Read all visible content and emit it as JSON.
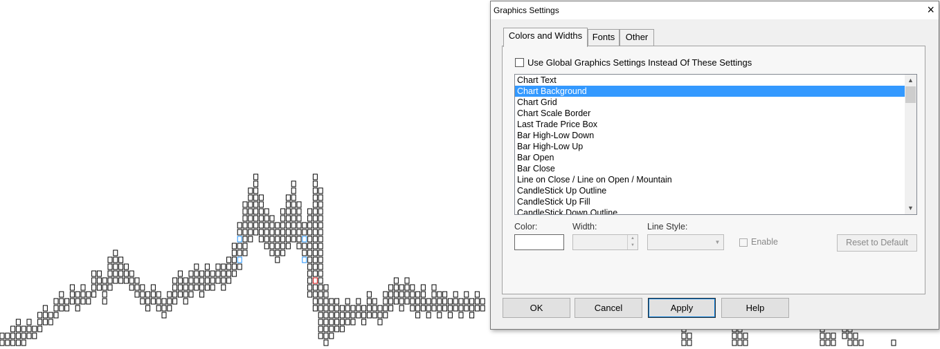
{
  "dialog": {
    "title": "Graphics Settings",
    "close_glyph": "×",
    "tabs": [
      {
        "label": "Colors and Widths",
        "active": true
      },
      {
        "label": "Fonts",
        "active": false
      },
      {
        "label": "Other",
        "active": false
      }
    ],
    "use_global_label": "Use Global Graphics Settings Instead Of These Settings",
    "use_global_checked": false,
    "list_items": [
      "Chart Text",
      "Chart Background",
      "Chart Grid",
      "Chart Scale Border",
      "Last Trade Price Box",
      "Bar High-Low Down",
      "Bar High-Low Up",
      "Bar Open",
      "Bar Close",
      "Line on Close / Line on Open / Mountain",
      "CandleStick Up Outline",
      "CandleStick Up Fill",
      "CandleStick Down Outline"
    ],
    "selected_index": 1,
    "color_label": "Color:",
    "width_label": "Width:",
    "line_style_label": "Line Style:",
    "color_value": "#ffffff",
    "enable_label": "Enable",
    "reset_label": "Reset to Default",
    "buttons": {
      "ok": "OK",
      "cancel": "Cancel",
      "apply": "Apply",
      "help": "Help"
    }
  },
  "chart_data": {
    "type": "point-and-figure",
    "box_color": "#000000",
    "highlight_color": "#1e90ff",
    "reversal_color": "#cc0000",
    "columns": [
      {
        "low": 0,
        "high": 1
      },
      {
        "low": 0,
        "high": 1
      },
      {
        "low": 0,
        "high": 2
      },
      {
        "low": 0,
        "high": 3
      },
      {
        "low": 0,
        "high": 2
      },
      {
        "low": 1,
        "high": 3
      },
      {
        "low": 1,
        "high": 2
      },
      {
        "low": 2,
        "high": 4
      },
      {
        "low": 3,
        "high": 5
      },
      {
        "low": 3,
        "high": 4
      },
      {
        "low": 4,
        "high": 6
      },
      {
        "low": 5,
        "high": 7
      },
      {
        "low": 5,
        "high": 6
      },
      {
        "low": 6,
        "high": 8
      },
      {
        "low": 5,
        "high": 7
      },
      {
        "low": 6,
        "high": 8
      },
      {
        "low": 6,
        "high": 7
      },
      {
        "low": 7,
        "high": 10
      },
      {
        "low": 8,
        "high": 10
      },
      {
        "low": 6,
        "high": 9
      },
      {
        "low": 8,
        "high": 12
      },
      {
        "low": 9,
        "high": 13
      },
      {
        "low": 9,
        "high": 12
      },
      {
        "low": 9,
        "high": 11
      },
      {
        "low": 8,
        "high": 10
      },
      {
        "low": 7,
        "high": 9
      },
      {
        "low": 6,
        "high": 8
      },
      {
        "low": 5,
        "high": 7
      },
      {
        "low": 6,
        "high": 8
      },
      {
        "low": 5,
        "high": 7
      },
      {
        "low": 4,
        "high": 6
      },
      {
        "low": 5,
        "high": 7
      },
      {
        "low": 6,
        "high": 9
      },
      {
        "low": 7,
        "high": 10
      },
      {
        "low": 6,
        "high": 9
      },
      {
        "low": 7,
        "high": 10
      },
      {
        "low": 8,
        "high": 11
      },
      {
        "low": 7,
        "high": 10
      },
      {
        "low": 8,
        "high": 11
      },
      {
        "low": 8,
        "high": 10
      },
      {
        "low": 9,
        "high": 11
      },
      {
        "low": 8,
        "high": 11
      },
      {
        "low": 9,
        "high": 12
      },
      {
        "low": 10,
        "high": 14
      },
      {
        "low": 11,
        "high": 17
      },
      {
        "low": 13,
        "high": 20
      },
      {
        "low": 15,
        "high": 22
      },
      {
        "low": 16,
        "high": 24
      },
      {
        "low": 15,
        "high": 21
      },
      {
        "low": 14,
        "high": 19
      },
      {
        "low": 13,
        "high": 18
      },
      {
        "low": 12,
        "high": 17
      },
      {
        "low": 13,
        "high": 19
      },
      {
        "low": 14,
        "high": 21
      },
      {
        "low": 15,
        "high": 23
      },
      {
        "low": 14,
        "high": 20
      },
      {
        "low": 12,
        "high": 17
      },
      {
        "low": 7,
        "high": 19
      },
      {
        "low": 5,
        "high": 24
      },
      {
        "low": 1,
        "high": 22
      },
      {
        "low": 0,
        "high": 8
      },
      {
        "low": 1,
        "high": 6
      },
      {
        "low": 2,
        "high": 6
      },
      {
        "low": 2,
        "high": 5
      },
      {
        "low": 3,
        "high": 6
      },
      {
        "low": 3,
        "high": 5
      },
      {
        "low": 4,
        "high": 6
      },
      {
        "low": 3,
        "high": 5
      },
      {
        "low": 4,
        "high": 7
      },
      {
        "low": 4,
        "high": 6
      },
      {
        "low": 3,
        "high": 5
      },
      {
        "low": 4,
        "high": 7
      },
      {
        "low": 5,
        "high": 8
      },
      {
        "low": 6,
        "high": 9
      },
      {
        "low": 5,
        "high": 8
      },
      {
        "low": 6,
        "high": 9
      },
      {
        "low": 5,
        "high": 8
      },
      {
        "low": 4,
        "high": 7
      },
      {
        "low": 5,
        "high": 8
      },
      {
        "low": 4,
        "high": 6
      },
      {
        "low": 5,
        "high": 8
      },
      {
        "low": 4,
        "high": 7
      },
      {
        "low": 5,
        "high": 7
      },
      {
        "low": 4,
        "high": 6
      },
      {
        "low": 5,
        "high": 7
      },
      {
        "low": 4,
        "high": 6
      },
      {
        "low": 5,
        "high": 7
      },
      {
        "low": 4,
        "high": 6
      },
      {
        "low": 5,
        "high": 7
      },
      {
        "low": 5,
        "high": 6
      }
    ]
  }
}
